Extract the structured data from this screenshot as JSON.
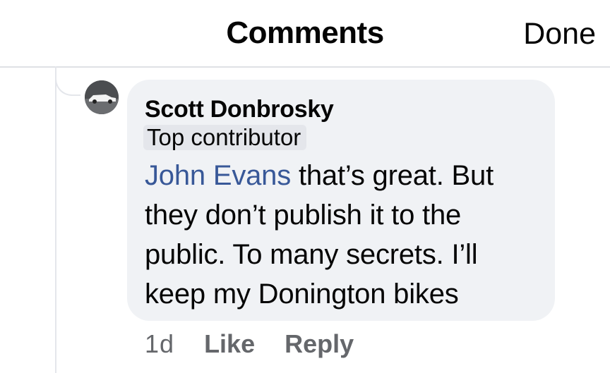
{
  "header": {
    "title": "Comments",
    "done_label": "Done"
  },
  "comment": {
    "avatar_icon": "car-photo-avatar",
    "author": "Scott Donbrosky",
    "badge": "Top contributor",
    "mention": "John Evans",
    "lines": [
      " that’s great.  But",
      "they don’t publish it to the",
      "public.  To many secrets.  I’ll",
      "keep my Donington bikes"
    ],
    "time": "1d",
    "like_label": "Like",
    "reply_label": "Reply"
  },
  "colors": {
    "bubble": "#f0f2f5",
    "mention": "#385898",
    "meta": "#65676b"
  }
}
